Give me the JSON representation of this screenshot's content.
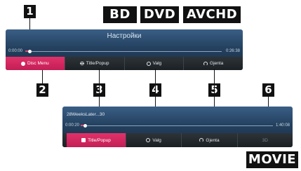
{
  "badges": {
    "bd": "BD",
    "dvd": "DVD",
    "avchd": "AVCHD",
    "movie": "MOVIE"
  },
  "callouts": [
    "1",
    "2",
    "3",
    "4",
    "5",
    "6"
  ],
  "disc_osd": {
    "title": "Настройки",
    "time_start": "0:00:00",
    "time_end": "0:26:38",
    "progress": 0.04,
    "menu": [
      {
        "label": "Disc Menu",
        "icon": "disc-menu-icon",
        "active": true
      },
      {
        "label": "Title/Popup",
        "icon": "title-popup-icon",
        "active": false
      },
      {
        "label": "Valg",
        "icon": "option-icon",
        "active": false
      },
      {
        "label": "Gjenta",
        "icon": "repeat-icon",
        "active": false
      }
    ]
  },
  "movie_osd": {
    "title": "28WeeksLater...30",
    "time_start": "0:00:20",
    "time_end": "1:40:08",
    "progress": 0.03,
    "menu": [
      {
        "label": "Title/Popup",
        "icon": "title-popup-icon",
        "active": true
      },
      {
        "label": "Valg",
        "icon": "option-icon",
        "active": false
      },
      {
        "label": "Gjenta",
        "icon": "repeat-icon",
        "active": false
      },
      {
        "label": "3D",
        "icon": "3d-icon",
        "active": false
      }
    ]
  },
  "colors": {
    "accent": "#d0245e",
    "panel": "#24415f",
    "menubar": "#22292d"
  }
}
